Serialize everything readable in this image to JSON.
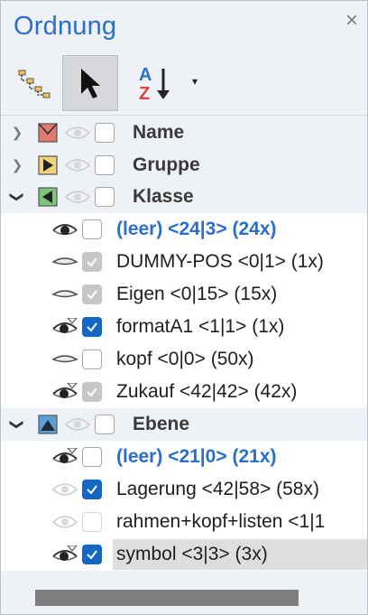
{
  "panel": {
    "title": "Ordnung",
    "close_glyph": "×"
  },
  "toolbar": {
    "buttons": [
      {
        "name": "hierarchy-view-icon",
        "active": false
      },
      {
        "name": "select-arrow-icon",
        "active": true
      },
      {
        "name": "sort-az-icon",
        "active": false
      }
    ],
    "dropdown_glyph": "▾"
  },
  "tree": {
    "groups": [
      {
        "label": "Name",
        "expanded": false,
        "icon": "name-flag-icon",
        "color": "#e07a6f"
      },
      {
        "label": "Gruppe",
        "expanded": false,
        "icon": "group-arrow-icon",
        "color": "#f2d27a"
      },
      {
        "label": "Klasse",
        "expanded": true,
        "icon": "class-arrow-icon",
        "color": "#7cc47c",
        "items": [
          {
            "label": "(leer) <24|3> (24x)",
            "leer": true,
            "eye": "open",
            "check": "empty"
          },
          {
            "label": "DUMMY-POS <0|1> (1x)",
            "leer": false,
            "eye": "closed",
            "check": "grey"
          },
          {
            "label": "Eigen <0|15> (15x)",
            "leer": false,
            "eye": "closed",
            "check": "grey"
          },
          {
            "label": "formatA1 <1|1> (1x)",
            "leer": false,
            "eye": "open-filter",
            "check": "checked"
          },
          {
            "label": "kopf <0|0> (50x)",
            "leer": false,
            "eye": "closed",
            "check": "empty"
          },
          {
            "label": "Zukauf <42|42> (42x)",
            "leer": false,
            "eye": "open-filter",
            "check": "grey"
          }
        ]
      },
      {
        "label": "Ebene",
        "expanded": true,
        "icon": "layer-mountain-icon",
        "color": "#5aa0d8",
        "items": [
          {
            "label": "(leer) <21|0> (21x)",
            "leer": true,
            "eye": "open-filter",
            "check": "empty"
          },
          {
            "label": "Lagerung <42|58> (58x)",
            "leer": false,
            "eye": "faded",
            "check": "checked"
          },
          {
            "label": "rahmen+kopf+listen <1|1",
            "leer": false,
            "eye": "faded",
            "check": "empty"
          },
          {
            "label": "symbol <3|3> (3x)",
            "leer": false,
            "eye": "open-filter",
            "check": "checked",
            "selected": true
          }
        ]
      }
    ]
  },
  "colors": {
    "accent": "#2a6fc9",
    "checkbox_checked": "#1467c3",
    "panel_bg": "#eef1f5"
  }
}
